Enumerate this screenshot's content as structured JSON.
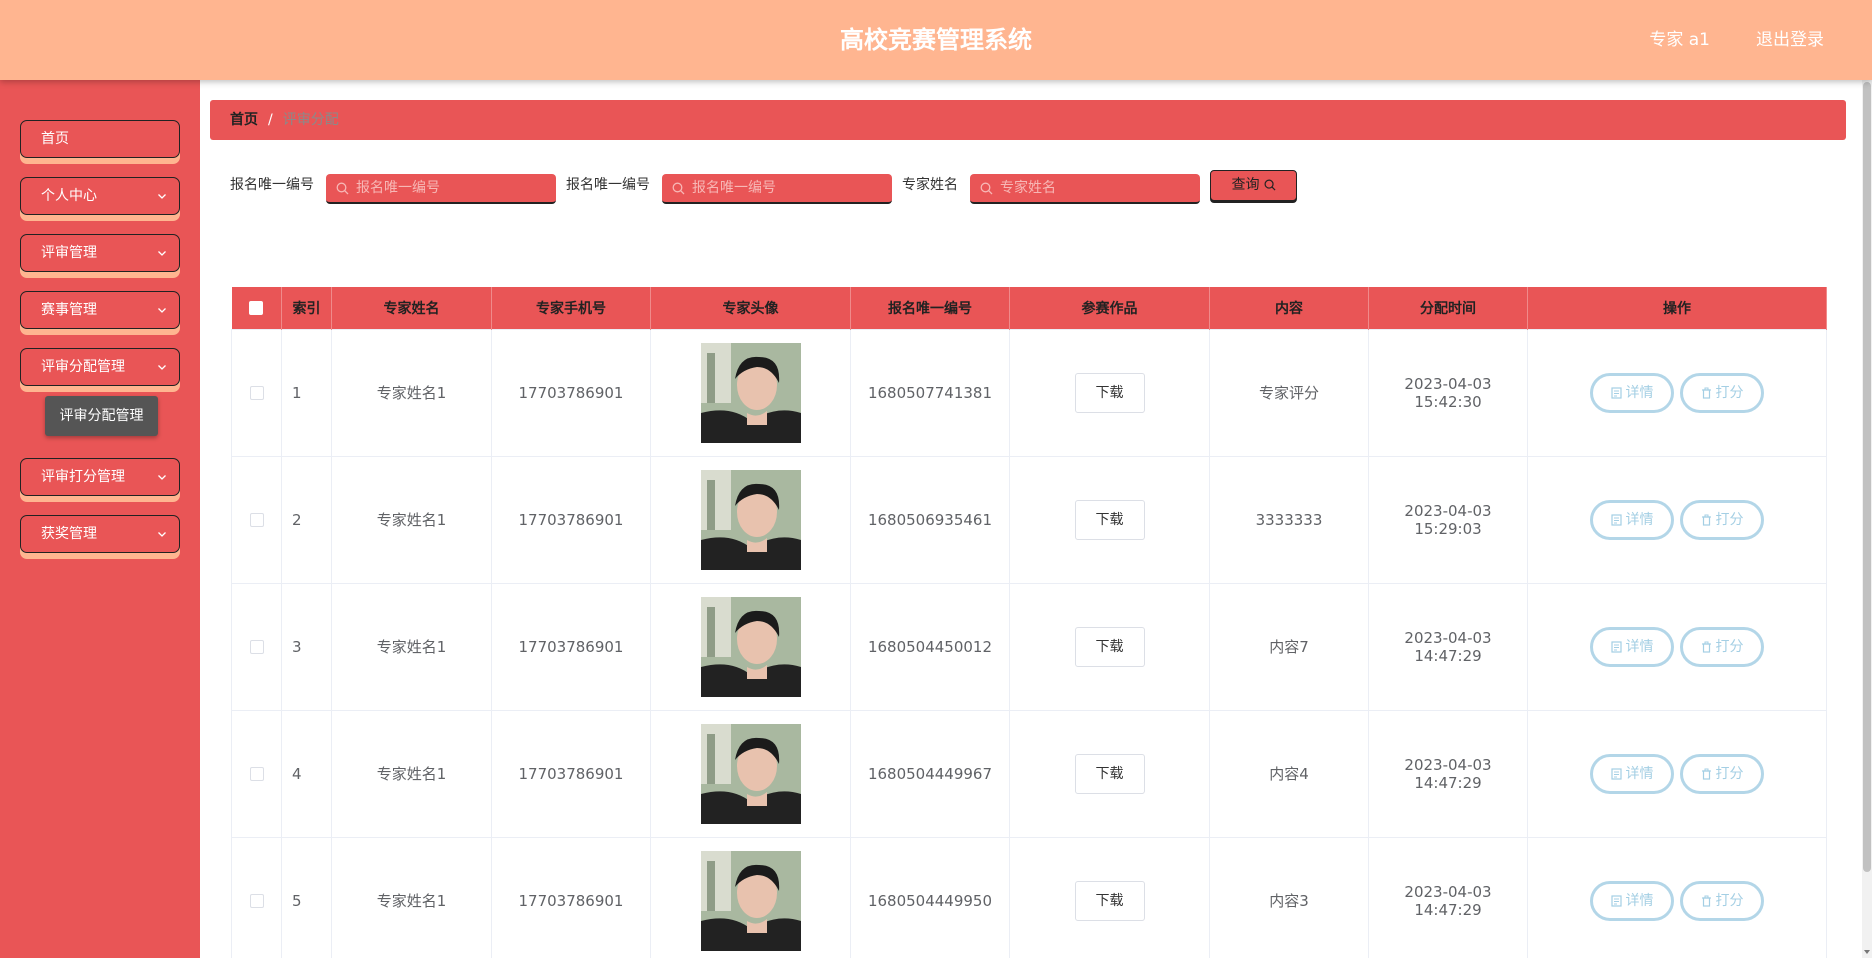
{
  "header": {
    "title": "高校竞赛管理系统",
    "user": "专家 a1",
    "logout": "退出登录"
  },
  "sidebar": {
    "items": [
      {
        "label": "首页",
        "has_arrow": false
      },
      {
        "label": "个人中心",
        "has_arrow": true
      },
      {
        "label": "评审管理",
        "has_arrow": true
      },
      {
        "label": "赛事管理",
        "has_arrow": true
      },
      {
        "label": "评审分配管理",
        "has_arrow": true
      },
      {
        "label": "评审打分管理",
        "has_arrow": true
      },
      {
        "label": "获奖管理",
        "has_arrow": true
      }
    ],
    "tooltip": "评审分配管理"
  },
  "breadcrumb": {
    "home": "首页",
    "separator": "/",
    "current": "评审分配"
  },
  "search": {
    "field1_label": "报名唯一编号",
    "field1_placeholder": "报名唯一编号",
    "field2_label": "报名唯一编号",
    "field2_placeholder": "报名唯一编号",
    "field3_label": "专家姓名",
    "field3_placeholder": "专家姓名",
    "query_button": "查询"
  },
  "table": {
    "headers": [
      "索引",
      "专家姓名",
      "专家手机号",
      "专家头像",
      "报名唯一编号",
      "参赛作品",
      "内容",
      "分配时间",
      "操作"
    ],
    "download_label": "下载",
    "detail_label": "详情",
    "score_label": "打分",
    "rows": [
      {
        "index": "1",
        "name": "专家姓名1",
        "phone": "17703786901",
        "reg_no": "1680507741381",
        "content": "专家评分",
        "time": "2023-04-03 15:42:30"
      },
      {
        "index": "2",
        "name": "专家姓名1",
        "phone": "17703786901",
        "reg_no": "1680506935461",
        "content": "3333333",
        "time": "2023-04-03 15:29:03"
      },
      {
        "index": "3",
        "name": "专家姓名1",
        "phone": "17703786901",
        "reg_no": "1680504450012",
        "content": "内容7",
        "time": "2023-04-03 14:47:29"
      },
      {
        "index": "4",
        "name": "专家姓名1",
        "phone": "17703786901",
        "reg_no": "1680504449967",
        "content": "内容4",
        "time": "2023-04-03 14:47:29"
      },
      {
        "index": "5",
        "name": "专家姓名1",
        "phone": "17703786901",
        "reg_no": "1680504449950",
        "content": "内容3",
        "time": "2023-04-03 14:47:29"
      }
    ]
  },
  "colors": {
    "header": "#ffb590",
    "accent": "#e95556",
    "op_border": "#b3d6e8"
  }
}
